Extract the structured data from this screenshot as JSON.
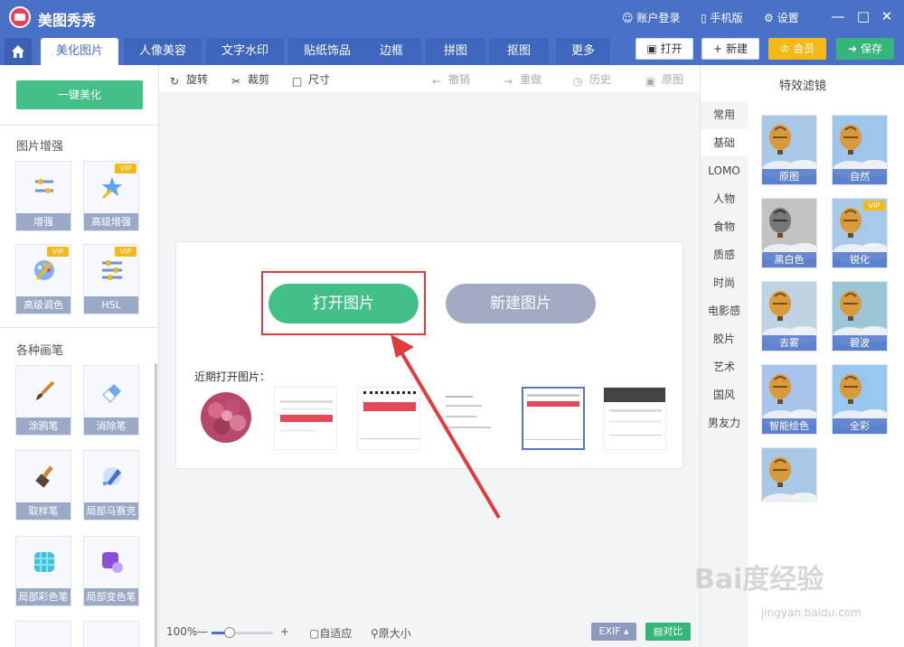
{
  "titlebar": {
    "app_title": "美图秀秀",
    "account": "账户登录",
    "mobile": "手机版",
    "settings": "设置"
  },
  "tabs": [
    "美化图片",
    "人像美容",
    "文字水印",
    "贴纸饰品",
    "边框",
    "拼图",
    "抠图",
    "更多"
  ],
  "actions": {
    "open": "打开",
    "new": "新建",
    "vip": "会员",
    "save": "保存"
  },
  "left": {
    "one_key": "一键美化",
    "section1": "图片增强",
    "section2": "各种画笔",
    "tools1": [
      {
        "label": "增强",
        "vip": ""
      },
      {
        "label": "高级增强",
        "vip": "VIP"
      },
      {
        "label": "高级调色",
        "vip": "VIP"
      },
      {
        "label": "HSL",
        "vip": "VIP"
      }
    ],
    "tools2": [
      {
        "label": "涂鸦笔"
      },
      {
        "label": "消除笔"
      },
      {
        "label": "取样笔"
      },
      {
        "label": "局部马赛克"
      },
      {
        "label": "局部彩色笔"
      },
      {
        "label": "局部变色笔"
      }
    ]
  },
  "toolbar": {
    "rotate": "旋转",
    "crop": "裁剪",
    "size": "尺寸",
    "undo": "撤销",
    "redo": "重做",
    "history": "历史",
    "original": "原图"
  },
  "main": {
    "open_image": "打开图片",
    "new_image": "新建图片",
    "recent_label": "近期打开图片："
  },
  "bottom": {
    "zoom": "100%",
    "fit": "自适应",
    "actual": "原大小",
    "exif": "EXIF",
    "compare": "对比"
  },
  "right": {
    "title": "特效滤镜",
    "categories": [
      "常用",
      "基础",
      "LOMO",
      "人物",
      "食物",
      "质感",
      "时尚",
      "电影感",
      "胶片",
      "艺术",
      "国风",
      "男友力"
    ],
    "filters": [
      {
        "label": "原图",
        "vip": ""
      },
      {
        "label": "自然",
        "vip": ""
      },
      {
        "label": "黑白色",
        "vip": ""
      },
      {
        "label": "锐化",
        "vip": "VIP"
      },
      {
        "label": "去雾",
        "vip": ""
      },
      {
        "label": "碧波",
        "vip": ""
      },
      {
        "label": "智能绘色",
        "vip": ""
      },
      {
        "label": "全彩",
        "vip": ""
      },
      {
        "label": "",
        "vip": ""
      }
    ]
  },
  "watermark": {
    "main": "Bai度经验",
    "sub": "jingyan.baidu.com"
  },
  "colors": {
    "brand": "#4a71c8",
    "green": "#43bf88",
    "gold": "#f4b817",
    "red": "#e13b3b"
  }
}
